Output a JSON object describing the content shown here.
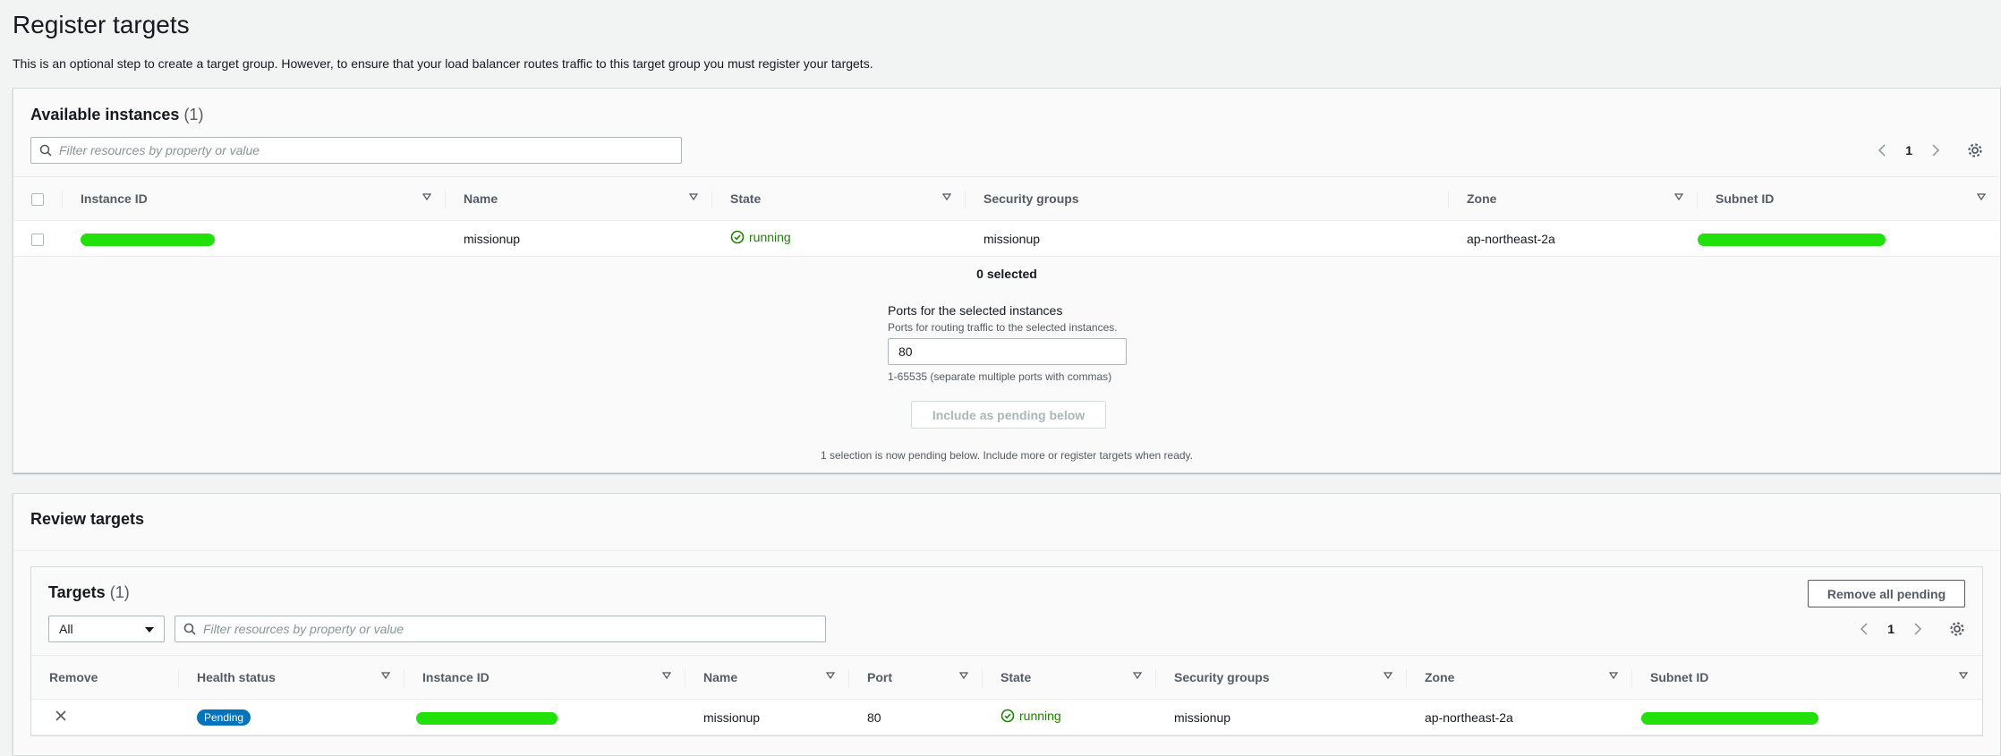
{
  "page": {
    "title": "Register targets",
    "description": "This is an optional step to create a target group. However, to ensure that your load balancer routes traffic to this target group you must register your targets."
  },
  "available": {
    "heading": "Available instances",
    "count": "(1)",
    "search_placeholder": "Filter resources by property or value",
    "page_number": "1",
    "columns": [
      "Instance ID",
      "Name",
      "State",
      "Security groups",
      "Zone",
      "Subnet ID"
    ],
    "rows": [
      {
        "name": "missionup",
        "state": "running",
        "security_groups": "missionup",
        "zone": "ap-northeast-2a"
      }
    ],
    "selected_text": "0 selected",
    "ports_label": "Ports for the selected instances",
    "ports_description": "Ports for routing traffic to the selected instances.",
    "ports_value": "80",
    "ports_hint": "1-65535 (separate multiple ports with commas)",
    "include_button": "Include as pending below",
    "pending_note": "1 selection is now pending below. Include more or register targets when ready."
  },
  "review": {
    "heading": "Review targets",
    "targets_heading": "Targets",
    "targets_count": "(1)",
    "remove_all_button": "Remove all pending",
    "filter_select": "All",
    "search_placeholder": "Filter resources by property or value",
    "page_number": "1",
    "columns": [
      "Remove",
      "Health status",
      "Instance ID",
      "Name",
      "Port",
      "State",
      "Security groups",
      "Zone",
      "Subnet ID"
    ],
    "rows": [
      {
        "health_status": "Pending",
        "name": "missionup",
        "port": "80",
        "state": "running",
        "security_groups": "missionup",
        "zone": "ap-northeast-2a"
      }
    ]
  },
  "colors": {
    "running": "#1d8102",
    "pending_badge": "#0073bb",
    "redaction": "#22e00a"
  }
}
